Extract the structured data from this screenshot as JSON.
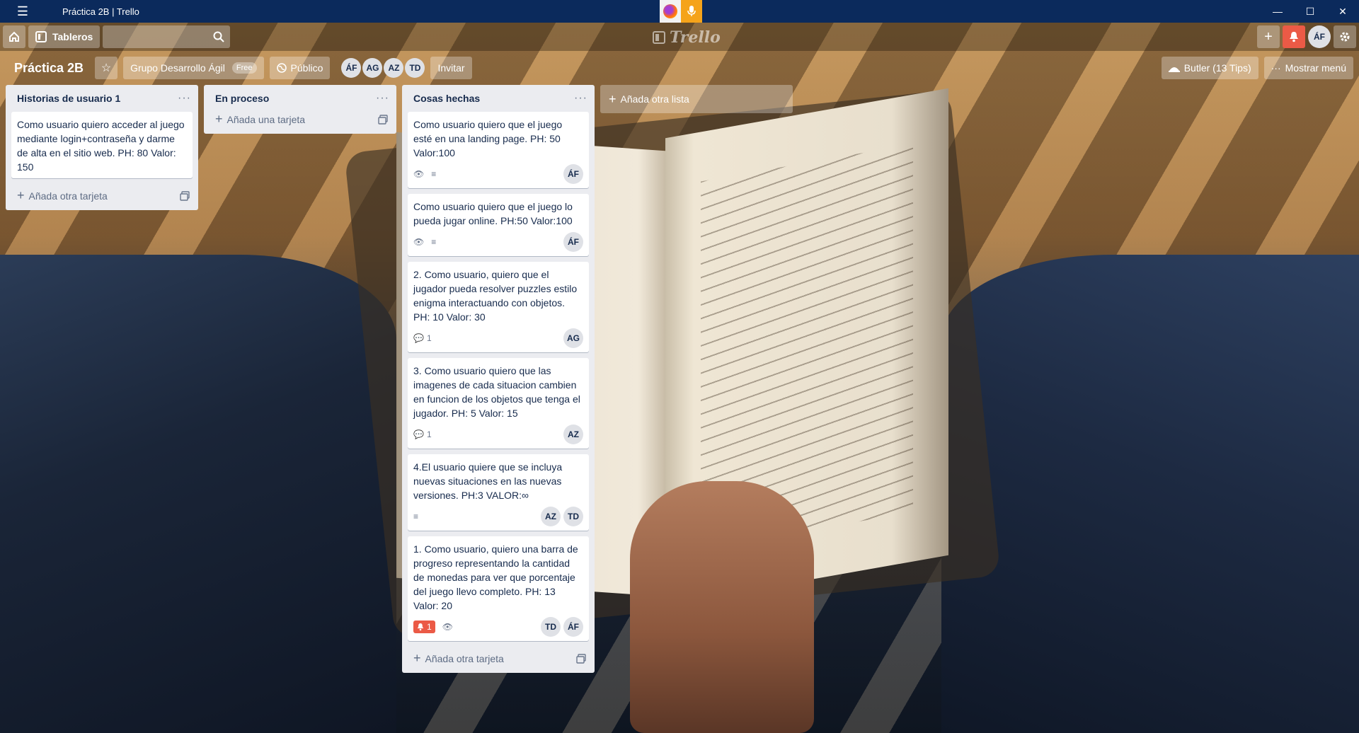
{
  "window": {
    "title": "Práctica 2B | Trello"
  },
  "header": {
    "boards_label": "Tableros",
    "search_placeholder": "",
    "logo_text": "Trello",
    "user_initials": "ÁF"
  },
  "board": {
    "title": "Práctica 2B",
    "team_label": "Grupo Desarrollo Ágil",
    "team_badge": "Free",
    "visibility_label": "Público",
    "members": [
      "ÁF",
      "AG",
      "AZ",
      "TD"
    ],
    "invite_label": "Invitar",
    "butler_label": "Butler (13 Tips)",
    "menu_label": "Mostrar menú"
  },
  "lists": [
    {
      "title": "Historias de usuario 1",
      "cards": [
        {
          "text": "Como usuario quiero acceder al juego mediante login+contraseña y darme de alta en el sitio web. PH: 80 Valor: 150"
        }
      ],
      "add_label": "Añada otra tarjeta"
    },
    {
      "title": "En proceso",
      "cards": [],
      "add_label": "Añada una tarjeta"
    },
    {
      "title": "Cosas hechas",
      "cards": [
        {
          "text": "Como usuario quiero que el juego esté en una landing page. PH: 50 Valor:100",
          "members": [
            "ÁF"
          ]
        },
        {
          "text": "Como usuario quiero que el juego lo pueda jugar online. PH:50 Valor:100",
          "members": [
            "ÁF"
          ]
        },
        {
          "text": "2. Como usuario, quiero que el jugador pueda resolver puzzles estilo enigma interactuando con objetos. PH: 10 Valor: 30",
          "comments": "1",
          "members": [
            "AG"
          ]
        },
        {
          "text": "3. Como usuario quiero que las imagenes de cada situacion cambien en funcion de los objetos que tenga el jugador. PH: 5 Valor: 15",
          "comments": "1",
          "members": [
            "AZ"
          ]
        },
        {
          "text": "4.El usuario quiere que se incluya nuevas situaciones en las nuevas versiones. PH:3 VALOR:∞",
          "members": [
            "AZ",
            "TD"
          ]
        },
        {
          "text": "1. Como usuario, quiero una barra de progreso representando la cantidad de monedas para ver que porcentaje del juego llevo completo. PH: 13 Valor: 20",
          "due": "1",
          "members": [
            "TD",
            "ÁF"
          ]
        }
      ],
      "add_label": "Añada otra tarjeta"
    }
  ],
  "add_list_label": "Añada otra lista",
  "colors": {
    "titlebar": "#0b2a5c",
    "list_bg": "#ebecf0",
    "alert": "#eb5a46"
  }
}
